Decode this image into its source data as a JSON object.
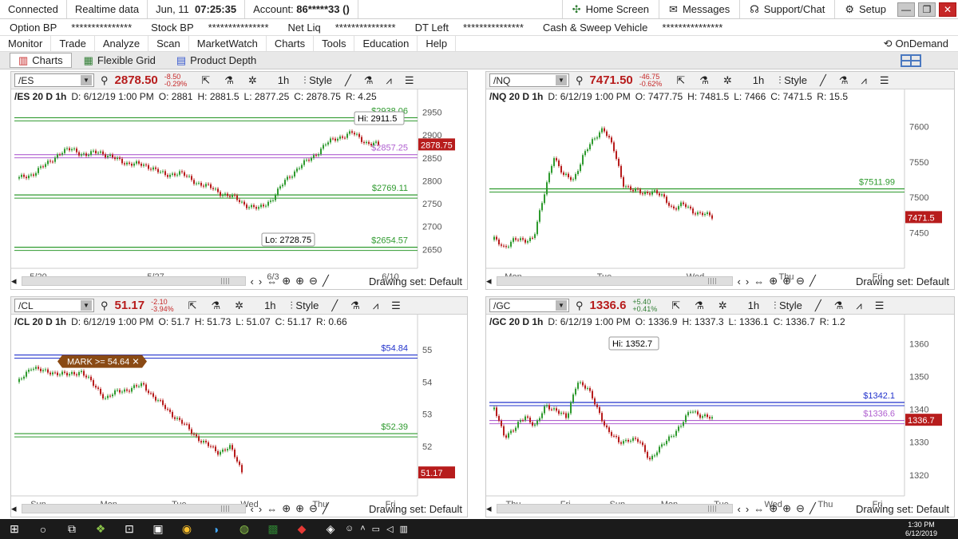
{
  "status": {
    "connected": "Connected",
    "feed": "Realtime data",
    "date": "Jun, 11",
    "time": "07:25:35",
    "account_label": "Account:",
    "account": "86*****33 ()",
    "home": "Home Screen",
    "messages": "Messages",
    "support": "Support/Chat",
    "setup": "Setup"
  },
  "account_bar": {
    "option_bp": "Option BP",
    "option_bp_val": "***************",
    "stock_bp": "Stock BP",
    "stock_bp_val": "***************",
    "net_liq": "Net Liq",
    "net_liq_val": "***************",
    "dt_left": "DT Left",
    "dt_left_val": "***************",
    "cash": "Cash & Sweep Vehicle",
    "cash_val": "***************"
  },
  "menu": {
    "items": [
      "Monitor",
      "Trade",
      "Analyze",
      "Scan",
      "MarketWatch",
      "Charts",
      "Tools",
      "Education",
      "Help"
    ],
    "ondemand": "OnDemand"
  },
  "subtabs": {
    "charts": "Charts",
    "flexible": "Flexible Grid",
    "depth": "Product Depth"
  },
  "common": {
    "timeframe": "1h",
    "style": "Style",
    "drawing": "Drawing set: Default"
  },
  "panels": [
    {
      "symbol": "/ES",
      "price": "2878.50",
      "chg": "-8.50",
      "pct": "-0.29%",
      "up": false,
      "desc": "/ES 20 D 1h",
      "date": "D: 6/12/19 1:00 PM",
      "o": "O: 2881",
      "h": "H: 2881.5",
      "l": "L: 2877.25",
      "c": "C: 2878.75",
      "r": "R: 4.25"
    },
    {
      "symbol": "/NQ",
      "price": "7471.50",
      "chg": "-46.75",
      "pct": "-0.62%",
      "up": false,
      "desc": "/NQ 20 D 1h",
      "date": "D: 6/12/19 1:00 PM",
      "o": "O: 7477.75",
      "h": "H: 7481.5",
      "l": "L: 7466",
      "c": "C: 7471.5",
      "r": "R: 15.5"
    },
    {
      "symbol": "/CL",
      "price": "51.17",
      "chg": "-2.10",
      "pct": "-3.94%",
      "up": false,
      "desc": "/CL 20 D 1h",
      "date": "D: 6/12/19 1:00 PM",
      "o": "O: 51.7",
      "h": "H: 51.73",
      "l": "L: 51.07",
      "c": "C: 51.17",
      "r": "R: 0.66"
    },
    {
      "symbol": "/GC",
      "price": "1336.6",
      "chg": "+5.40",
      "pct": "+0.41%",
      "up": true,
      "desc": "/GC 20 D 1h",
      "date": "D: 6/12/19 1:00 PM",
      "o": "O: 1336.9",
      "h": "H: 1337.3",
      "l": "L: 1336.1",
      "c": "C: 1336.7",
      "r": "R: 1.2"
    }
  ],
  "chart_data": [
    {
      "type": "line",
      "title": "/ES 20 D 1h",
      "ylim": [
        2640,
        2965
      ],
      "yticks": [
        2650,
        2700,
        2750,
        2800,
        2850,
        2900,
        2950
      ],
      "xticks": [
        "5/20",
        "5/27",
        "6/3",
        "6/10"
      ],
      "series": [
        {
          "values": [
            2805,
            2815,
            2835,
            2860,
            2870,
            2855,
            2865,
            2850,
            2840,
            2835,
            2830,
            2810,
            2820,
            2800,
            2790,
            2775,
            2765,
            2748,
            2738,
            2760,
            2800,
            2830,
            2850,
            2880,
            2895,
            2905,
            2885,
            2878
          ]
        }
      ],
      "levels": [
        {
          "value": 2938.06,
          "label": "$2938.06",
          "color": "#2e9a2e"
        },
        {
          "value": 2857.25,
          "label": "$2857.25",
          "color": "#b060d0"
        },
        {
          "value": 2769.11,
          "label": "$2769.11",
          "color": "#2e9a2e"
        },
        {
          "value": 2654.57,
          "label": "$2654.57",
          "color": "#2e9a2e"
        }
      ],
      "hi": "Hi: 2911.5",
      "lo": "Lo: 2728.75",
      "last": "2878.75"
    },
    {
      "type": "line",
      "title": "/NQ 20 D 1h",
      "ylim": [
        7420,
        7630
      ],
      "yticks": [
        7450,
        7500,
        7550,
        7600
      ],
      "xticks": [
        "Mon",
        "Tue",
        "Wed",
        "Thu",
        "Fri"
      ],
      "series": [
        {
          "values": [
            7440,
            7430,
            7440,
            7438,
            7445,
            7500,
            7560,
            7530,
            7525,
            7560,
            7580,
            7600,
            7570,
            7520,
            7510,
            7505,
            7510,
            7500,
            7485,
            7490,
            7480,
            7478,
            7471
          ]
        }
      ],
      "levels": [
        {
          "value": 7511.99,
          "label": "$7511.99",
          "color": "#2e9a2e"
        }
      ],
      "last": "7471.5"
    },
    {
      "type": "line",
      "title": "/CL 20 D 1h",
      "ylim": [
        50.9,
        55.6
      ],
      "yticks": [
        52,
        53,
        54,
        55
      ],
      "xticks": [
        "Sun",
        "Mon",
        "Tue",
        "Wed",
        "Thu",
        "Fri"
      ],
      "series": [
        {
          "values": [
            54.0,
            54.5,
            54.3,
            54.3,
            54.2,
            54.35,
            53.9,
            53.5,
            53.7,
            53.8,
            53.9,
            53.5,
            53.1,
            52.8,
            52.4,
            52.1,
            51.8,
            52.0,
            51.2
          ]
        }
      ],
      "levels": [
        {
          "value": 54.84,
          "label": "$54.84",
          "color": "#2233cc"
        },
        {
          "value": 52.39,
          "label": "$52.39",
          "color": "#2e9a2e"
        }
      ],
      "alert": "MARK >= 54.64",
      "last": "51.17"
    },
    {
      "type": "line",
      "title": "/GC 20 D 1h",
      "ylim": [
        1318,
        1364
      ],
      "yticks": [
        1320,
        1330,
        1340,
        1350,
        1360
      ],
      "xticks": [
        "Thu",
        "Fri",
        "Sun",
        "Mon",
        "Tue",
        "Wed",
        "Thu",
        "Fri"
      ],
      "series": [
        {
          "values": [
            1340,
            1332,
            1334,
            1338,
            1335,
            1341,
            1340,
            1337,
            1349,
            1346,
            1340,
            1333,
            1330,
            1331,
            1330,
            1325,
            1328,
            1332,
            1335,
            1340,
            1338,
            1337
          ]
        }
      ],
      "levels": [
        {
          "value": 1342.1,
          "label": "$1342.1",
          "color": "#2233cc"
        },
        {
          "value": 1336.6,
          "label": "$1336.6",
          "color": "#b060d0"
        }
      ],
      "hi": "Hi: 1352.7",
      "last": "1336.7"
    }
  ],
  "taskbar": {
    "time": "1:30 PM",
    "date": "6/12/2019"
  }
}
